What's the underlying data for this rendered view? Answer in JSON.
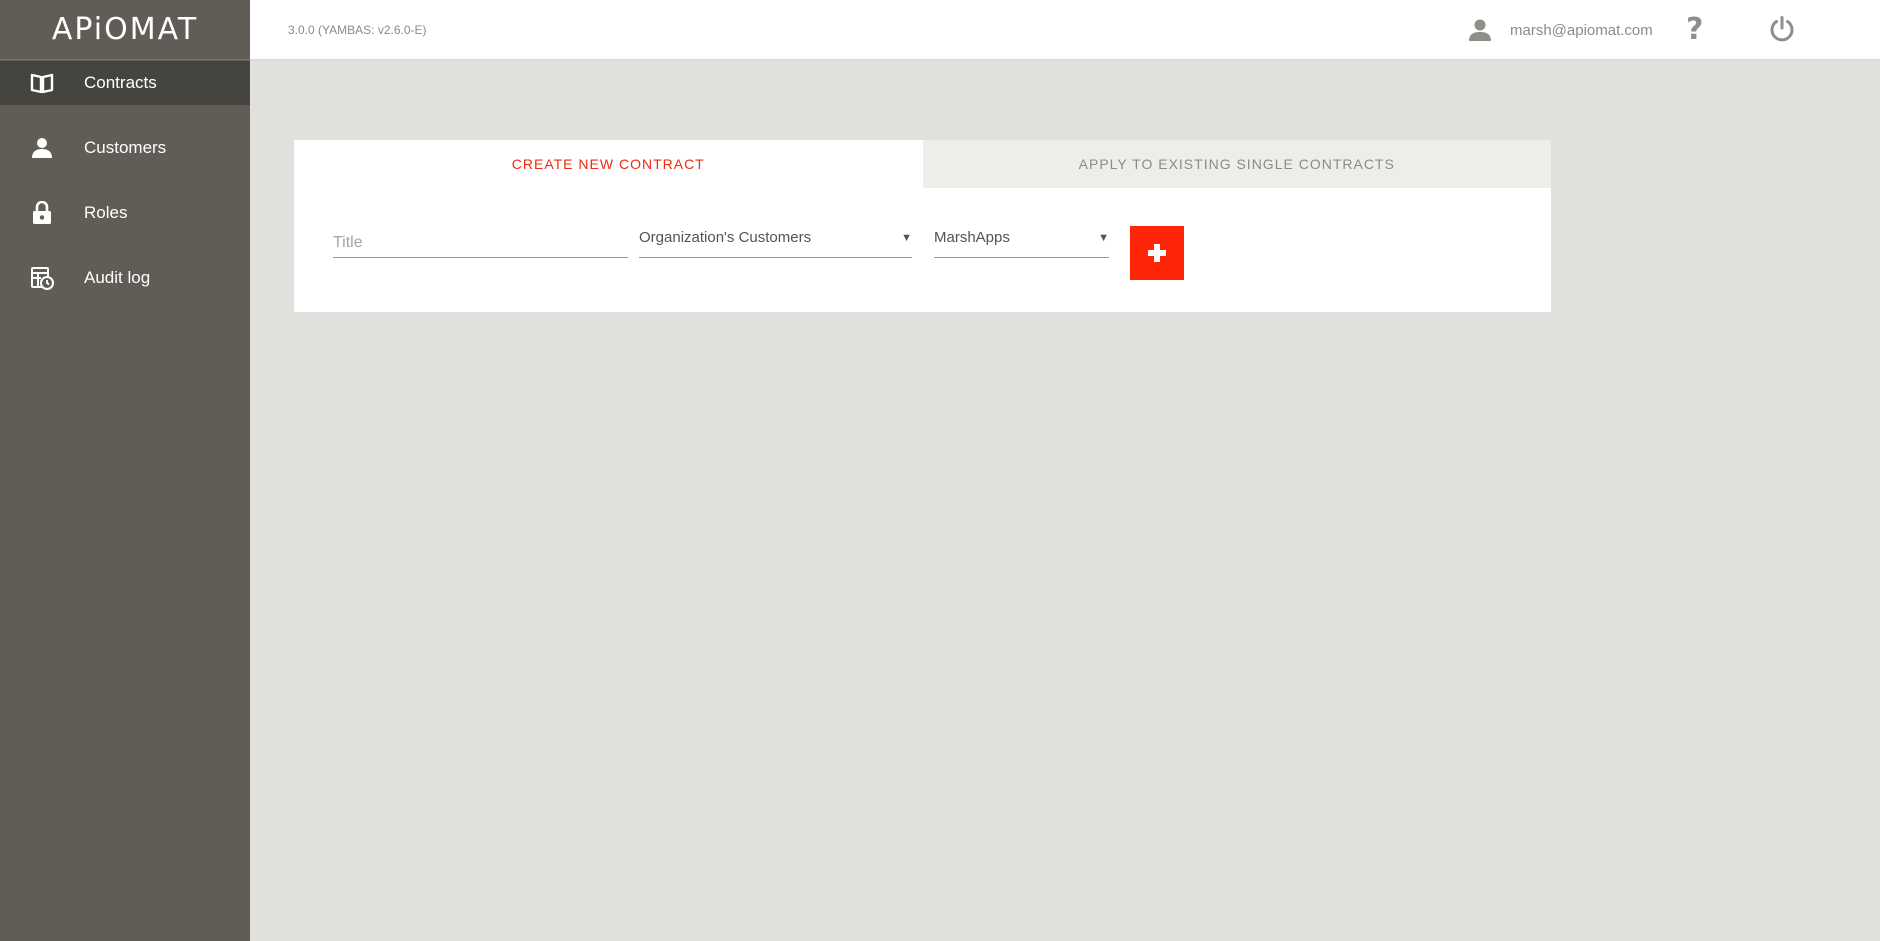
{
  "brand": {
    "logo_text": "APiOMAT"
  },
  "sidebar": {
    "items": [
      {
        "label": "Contracts",
        "icon": "book-icon",
        "active": true
      },
      {
        "label": "Customers",
        "icon": "person-icon",
        "active": false
      },
      {
        "label": "Roles",
        "icon": "lock-icon",
        "active": false
      },
      {
        "label": "Audit log",
        "icon": "audit-log-icon",
        "active": false
      }
    ]
  },
  "topbar": {
    "version": "3.0.0 (YAMBAS: v2.6.0-E)",
    "user_email": "marsh@apiomat.com",
    "help_symbol": "?"
  },
  "main": {
    "tabs": [
      {
        "label": "CREATE NEW CONTRACT",
        "active": true
      },
      {
        "label": "APPLY TO EXISTING SINGLE CONTRACTS",
        "active": false
      }
    ],
    "form": {
      "title_placeholder": "Title",
      "title_value": "",
      "customers_select": "Organization's Customers",
      "apps_select": "MarshApps",
      "add_button_symbol": "+"
    }
  },
  "colors": {
    "accent": "#ff2508",
    "sidebar_bg": "#5f5d55",
    "sidebar_active": "#45443f",
    "page_bg": "#e1e0dc"
  }
}
